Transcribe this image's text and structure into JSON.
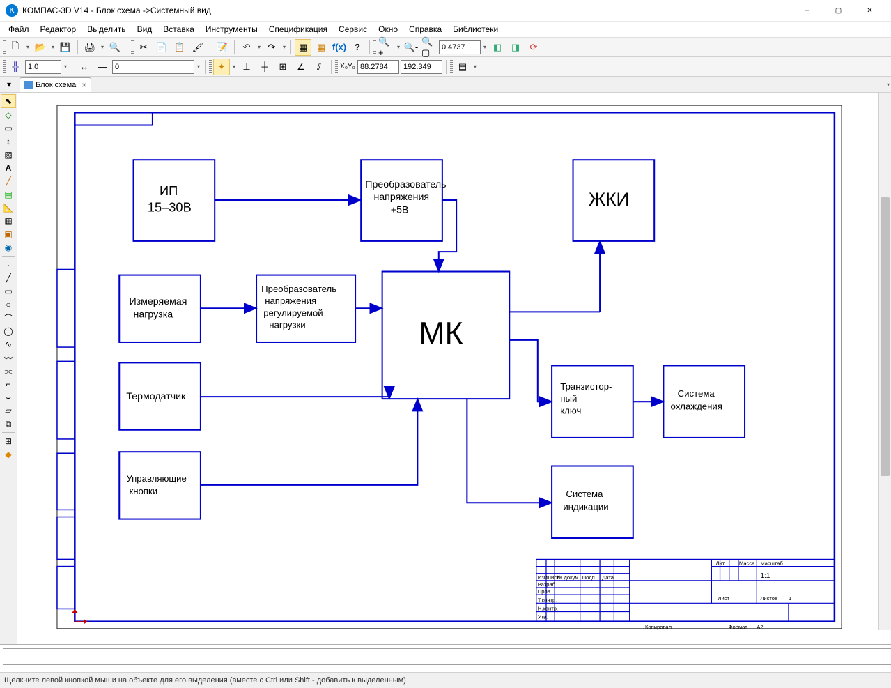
{
  "title": "КОМПАС-3D V14 - Блок схема ->Системный вид",
  "menu": [
    "Файл",
    "Редактор",
    "Выделить",
    "Вид",
    "Вставка",
    "Инструменты",
    "Спецификация",
    "Сервис",
    "Окно",
    "Справка",
    "Библиотеки"
  ],
  "menu_u": [
    "Ф",
    "Р",
    "ы",
    "В",
    "а",
    "И",
    "п",
    "С",
    "О",
    "С",
    "Б"
  ],
  "tab": {
    "label": "Блок схема"
  },
  "toolbar2": {
    "scale": "1.0",
    "style": "0",
    "coord_x": "88.2784",
    "coord_y": "192.349"
  },
  "zoom": "0.4737",
  "status": "Щелкните левой кнопкой мыши на объекте для его выделения (вместе с Ctrl или Shift - добавить к выделенным)",
  "blocks": {
    "b1_l1": "ИП",
    "b1_l2": "15–30В",
    "b2_l1": "Преобразователь",
    "b2_l2": "напряжения",
    "b2_l3": "+5В",
    "b3_l1": "ЖКИ",
    "b4_l1": "Измеряемая",
    "b4_l2": "нагрузка",
    "b5_l1": "Преобразователь",
    "b5_l2": "напряжения",
    "b5_l3": "регулируемой",
    "b5_l4": "нагрузки",
    "b6_l1": "МК",
    "b7_l1": "Термодатчик",
    "b8_l1": "Транзистор-",
    "b8_l2": "ный",
    "b8_l3": "ключ",
    "b9_l1": "Система",
    "b9_l2": "охлаждения",
    "b10_l1": "Управляющие",
    "b10_l2": "кнопки",
    "b11_l1": "Система",
    "b11_l2": "индикации"
  },
  "stamp": {
    "r1": "Изм",
    "r1b": "Лист",
    "r1c": "№ докум.",
    "r1d": "Подп.",
    "r1e": "Дата",
    "r2": "Разраб.",
    "r3": "Пров.",
    "r4": "Т.контр.",
    "r5": "Н.контр.",
    "r6": "Утв.",
    "lit": "Лит.",
    "massa": "Масса",
    "mashtab": "Масштаб",
    "scale": "1:1",
    "list": "Лист",
    "listov": "Листов",
    "n1": "1",
    "kopir": "Копировал",
    "format": "Формат",
    "a2": "A2"
  }
}
